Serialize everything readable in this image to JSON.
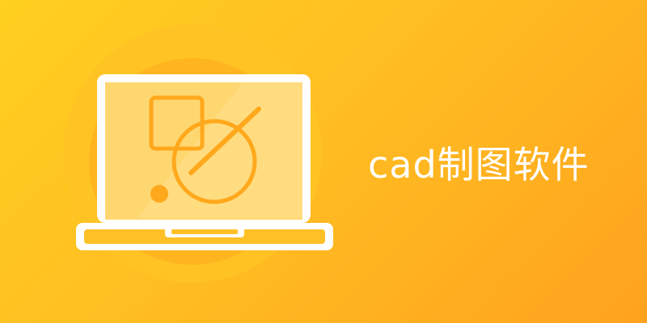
{
  "banner": {
    "title": "cad制图软件"
  },
  "colors": {
    "background_start": "#FFD020",
    "background_end": "#FFA21E",
    "halo_outer": "#FFC022",
    "halo_inner": "#FFB21E",
    "screen": "#FFD86E",
    "drawing_stroke": "#FFA81C",
    "frame": "#FFFFFF",
    "text": "#FFFFFF"
  },
  "icons": {
    "laptop": "laptop-icon",
    "square": "square-shape-icon",
    "circle": "circle-shape-icon",
    "slash": "slash-line-icon",
    "dot": "dot-shape-icon"
  }
}
